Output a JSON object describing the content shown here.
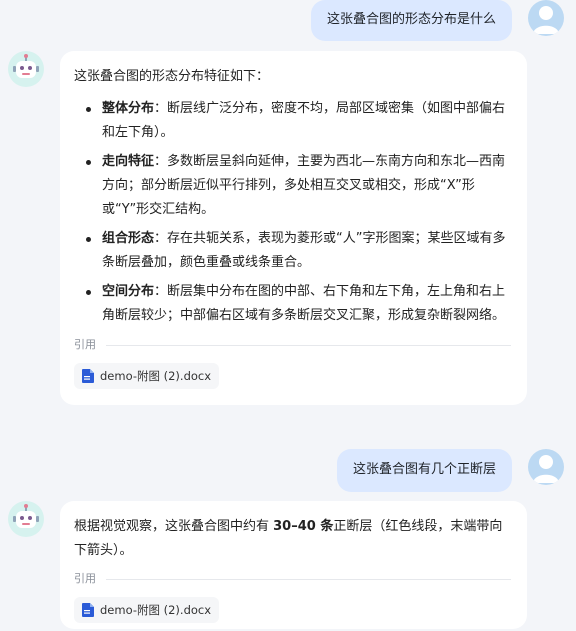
{
  "conversation": {
    "q1": "这张叠合图的形态分布是什么",
    "a1": {
      "intro": "这张叠合图的形态分布特征如下：",
      "points": [
        {
          "term": "整体分布",
          "text": "：断层线广泛分布，密度不均，局部区域密集（如图中部偏右和左下角）。"
        },
        {
          "term": "走向特征",
          "text": "：多数断层呈斜向延伸，主要为西北—东南方向和东北—西南方向；部分断层近似平行排列，多处相互交叉或相交，形成“X”形或“Y”形交汇结构。"
        },
        {
          "term": "组合形态",
          "text": "：存在共轭关系，表现为菱形或“人”字形图案；某些区域有多条断层叠加，颜色重叠或线条重合。"
        },
        {
          "term": "空间分布",
          "text": "：断层集中分布在图的中部、右下角和左下角，左上角和右上角断层较少；中部偏右区域有多条断层交叉汇聚，形成复杂断裂网络。"
        }
      ],
      "cite_label": "引用",
      "file_name": "demo-附图 (2).docx"
    },
    "q2": "这张叠合图有几个正断层",
    "a2": {
      "text_before": "根据视觉观察，这张叠合图中约有 ",
      "count": "30–40 条",
      "text_after": "正断层（红色线段，末端带向下箭头）。",
      "cite_label": "引用",
      "file_name": "demo-附图 (2).docx"
    }
  },
  "icons": {
    "user_avatar": "user-avatar-icon",
    "bot_avatar": "robot-avatar-icon",
    "doc": "word-doc-icon"
  },
  "colors": {
    "user_bubble": "#dbe8ff",
    "card": "#ffffff",
    "background": "#f3f5f9",
    "doc_icon": "#2b5bd7"
  }
}
